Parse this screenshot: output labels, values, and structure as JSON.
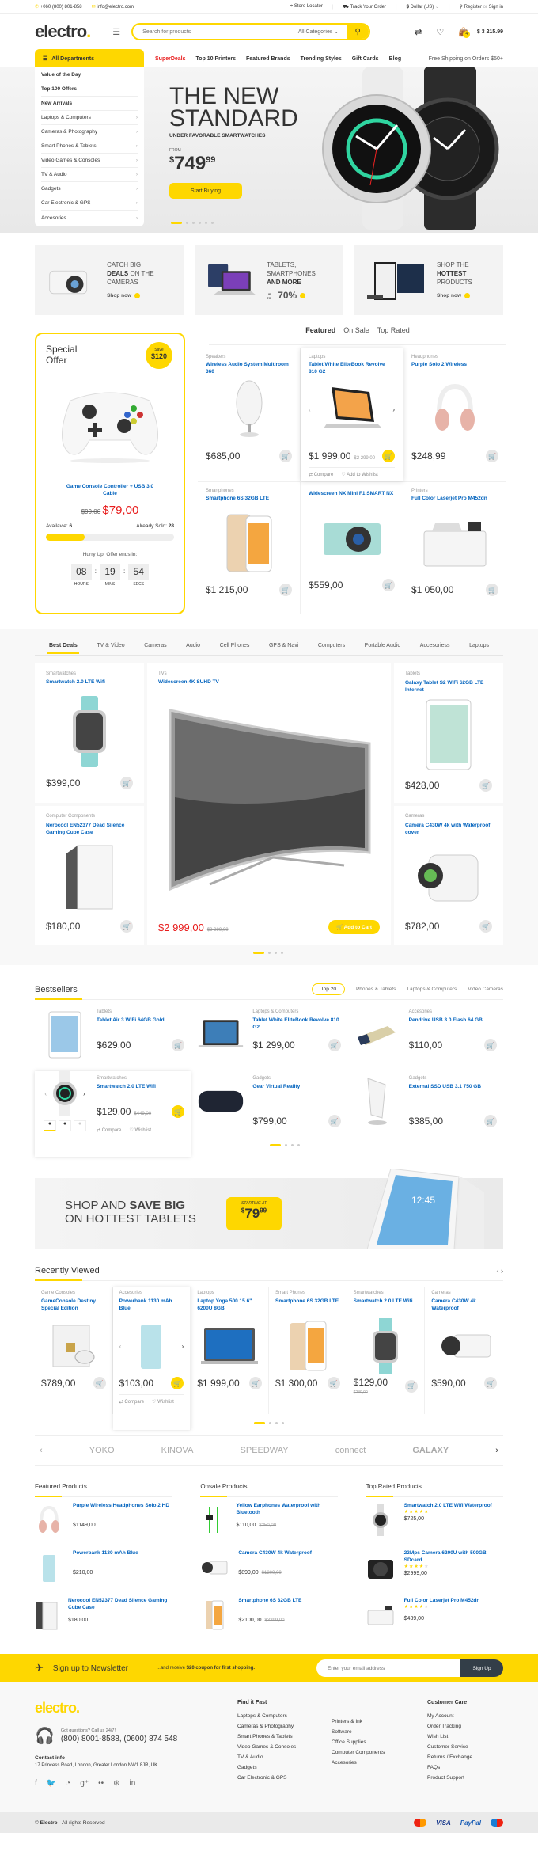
{
  "topbar": {
    "phone": "+060 (800) 801-858",
    "email": "info@electro.com",
    "store_locator": "Store Locator",
    "track_order": "Track Your Order",
    "currency": "Dollar (US)",
    "register": "Register",
    "or": "or",
    "sign_in": "Sign in"
  },
  "header": {
    "logo": "electro",
    "search_placeholder": "Search for products",
    "category_select": "All Categories",
    "cart_count": "4",
    "cart_total": "$ 3 215.99"
  },
  "nav": {
    "all_departments": "All Departments",
    "items": [
      "SuperDeals",
      "Top 10 Printers",
      "Featured Brands",
      "Trending Styles",
      "Gift Cards",
      "Blog"
    ],
    "free_shipping": "Free Shipping on Orders $50+"
  },
  "departments": [
    {
      "label": "Value of the Day",
      "bold": true
    },
    {
      "label": "Top 100 Offers",
      "bold": true
    },
    {
      "label": "New Arrivals",
      "bold": true
    },
    {
      "label": "Laptops & Computers"
    },
    {
      "label": "Cameras & Photography"
    },
    {
      "label": "Smart Phones & Tablets"
    },
    {
      "label": "Video Games & Consoles"
    },
    {
      "label": "TV & Audio"
    },
    {
      "label": "Gadgets"
    },
    {
      "label": "Car Electronic & GPS"
    },
    {
      "label": "Accesories"
    }
  ],
  "hero": {
    "line1": "THE NEW",
    "line2": "STANDARD",
    "subtitle": "UNDER FAVORABLE SMARTWATCHES",
    "from": "FROM",
    "price_main": "749",
    "price_cents": "99",
    "currency": "$",
    "button": "Start Buying",
    "slides": 6,
    "active_slide": 1
  },
  "banners": [
    {
      "pre": "CATCH BIG",
      "bold": "DEALS",
      "post": "ON THE CAMERAS",
      "cta": "Shop now"
    },
    {
      "pre": "TABLETS, SMARTPHONES",
      "bold": "AND MORE",
      "post": "",
      "cta_up": "UP TO",
      "cta": "70%"
    },
    {
      "pre": "SHOP THE",
      "bold": "HOTTEST",
      "post": "PRODUCTS",
      "cta": "Shop now"
    }
  ],
  "special_offer": {
    "title_1": "Special",
    "title_2": "Offer",
    "save_label": "Save",
    "save_amount": "$120",
    "name": "Game Console Controller + USB 3.0 Cable",
    "old_price": "$99,00",
    "price": "$79,00",
    "available_label": "Availavle:",
    "available": "6",
    "sold_label": "Already Sold:",
    "sold": "28",
    "progress_percent": 30,
    "hurry": "Hurry Up! Offer ends in:",
    "hours": "08",
    "mins": "19",
    "secs": "54",
    "hours_label": "HOURS",
    "mins_label": "MINS",
    "secs_label": "SECS"
  },
  "featured_tabs": [
    "Featured",
    "On Sale",
    "Top Rated"
  ],
  "featured_products": [
    {
      "cat": "Speakers",
      "name": "Wireless Audio System Multiroom 360",
      "price": "$685,00"
    },
    {
      "cat": "Laptops",
      "name": "Tablet White EliteBook Revolve 810 G2",
      "price": "$1 999,00",
      "old": "$2 299,00",
      "sale": true,
      "hover": true
    },
    {
      "cat": "Headphones",
      "name": "Purple Solo 2 Wireless",
      "price": "$248,99"
    },
    {
      "cat": "Smartphones",
      "name": "Smartphone 6S 32GB LTE",
      "price": "$1 215,00"
    },
    {
      "cat": "",
      "name": "Widescreen NX Mini F1 SMART NX",
      "price": "$559,00"
    },
    {
      "cat": "Printers",
      "name": "Full Color Laserjet Pro M452dn",
      "price": "$1 050,00"
    }
  ],
  "actions": {
    "compare": "Compare",
    "wishlist": "Add to Wishlist",
    "wishlist_short": "Wishlist",
    "add_to_cart": "Add to Cart"
  },
  "deal_tabs": [
    "Best Deals",
    "TV & Video",
    "Cameras",
    "Audio",
    "Cell Phones",
    "GPS & Navi",
    "Computers",
    "Portable Audio",
    "Accesoriess",
    "Laptops"
  ],
  "deals": {
    "left_top": {
      "cat": "Smartwatches",
      "name": "Smartwatch 2.0 LTE Wifi",
      "price": "$399,00"
    },
    "left_bottom": {
      "cat": "Computer Components",
      "name": "Nerocool EN52377 Dead Silence Gaming Cube Case",
      "price": "$180,00"
    },
    "center": {
      "cat": "TVs",
      "name": "Widescreen 4K SUHD TV",
      "price": "$2 999,00",
      "old": "$3 299,00"
    },
    "right_top": {
      "cat": "Tablets",
      "name": "Galaxy Tablet S2 WiFi 62GB LTE Internet",
      "price": "$428,00"
    },
    "right_bottom": {
      "cat": "Cameras",
      "name": "Camera C430W 4k with Waterproof cover",
      "price": "$782,00"
    }
  },
  "bestsellers": {
    "title": "Bestsellers",
    "tabs": [
      "Top 20",
      "Phones & Tablets",
      "Laptops & Computers",
      "Video Cameras"
    ],
    "items": [
      {
        "cat": "Tablets",
        "name": "Tablet Air 3 WiFi 64GB Gold",
        "price": "$629,00"
      },
      {
        "cat": "Laptops & Computers",
        "name": "Tablet White EliteBook Revolve 810 G2",
        "price": "$1 299,00"
      },
      {
        "cat": "Accesories",
        "name": "Pendrive USB 3.0 Flash 64 GB",
        "price": "$110,00"
      },
      {
        "cat": "Smartwatches",
        "name": "Smartwatch 2.0 LTE Wifi",
        "price": "$129,00",
        "old": "$449,00",
        "sale": true
      },
      {
        "cat": "Gadgets",
        "name": "Gear Virtual Reality",
        "price": "$799,00"
      },
      {
        "cat": "Gadgets",
        "name": "External SSD USB 3.1 750 GB",
        "price": "$385,00"
      }
    ]
  },
  "tablet_banner": {
    "line1_pre": "SHOP AND",
    "line1_bold": "SAVE BIG",
    "line2": "ON HOTTEST TABLETS",
    "starting": "STARTING AT",
    "price_main": "79",
    "price_cents": "99",
    "currency": "$",
    "screen_time": "12:45"
  },
  "recently_viewed": {
    "title": "Recently Viewed",
    "items": [
      {
        "cat": "Game Consoles",
        "name": "GameConsole Destiny Special Edition",
        "price": "$789,00"
      },
      {
        "cat": "Accesories",
        "name": "Powerbank 1130 mAh Blue",
        "price": "$103,00",
        "hover": true
      },
      {
        "cat": "Laptops",
        "name": "Laptop Yoga 500 15.6\" 6200U 8GB",
        "price": "$1 999,00"
      },
      {
        "cat": "Smart Phones",
        "name": "Smartphone 6S 32GB LTE",
        "price": "$1 300,00"
      },
      {
        "cat": "Smartwatches",
        "name": "Smartwatch 2.0 LTE Wifi",
        "price": "$129,00",
        "old": "$249,00",
        "sale": true
      },
      {
        "cat": "Cameras",
        "name": "Camera C430W 4k Waterproof",
        "price": "$590,00"
      }
    ]
  },
  "brands": [
    "YOKO",
    "KINOVA",
    "SPEEDWAY",
    "connect",
    "GALAXY"
  ],
  "lists": [
    {
      "title": "Featured Products",
      "items": [
        {
          "name": "Purple Wireless Headphones Solo 2 HD",
          "price": "$1149,00"
        },
        {
          "name": "Powerbank 1130 mAh Blue",
          "price": "$210,00"
        },
        {
          "name": "Nerocool EN52377 Dead Silence Gaming Cube Case",
          "price": "$180,00"
        }
      ]
    },
    {
      "title": "Onsale Products",
      "items": [
        {
          "name": "Yellow Earphones Waterproof with Bluetooth",
          "price": "$110,00",
          "old": "$250,00"
        },
        {
          "name": "Camera C430W 4k Waterproof",
          "price": "$899,00",
          "old": "$1200,00"
        },
        {
          "name": "Smartphone 6S 32GB LTE",
          "price": "$2100,00",
          "old": "$3299,00"
        }
      ]
    },
    {
      "title": "Top Rated Products",
      "items": [
        {
          "name": "Smartwatch 2.0 LTE Wifi Waterproof",
          "price": "$725,00",
          "rating": 5
        },
        {
          "name": "22Mps Camera 6200U with 500GB SDcard",
          "price": "$2999,00",
          "rating": 4
        },
        {
          "name": "Full Color Laserjet Pro M452dn",
          "price": "$439,00",
          "rating": 4
        }
      ]
    }
  ],
  "newsletter": {
    "title": "Sign up to Newsletter",
    "sub_pre": "...and receive",
    "sub_bold": "$20 coupon for first shopping.",
    "placeholder": "Enter your email address",
    "button": "Sign Up"
  },
  "footer": {
    "logo": "electro",
    "questions": "Got questions? Call us 24/7!",
    "phones": "(800) 8001-8588, (0600) 874 548",
    "contact_title": "Contact info",
    "address": "17 Princess Road, London, Greater London NW1 8JR, UK",
    "find_title": "Find it Fast",
    "find_col1": [
      "Laptops & Computers",
      "Cameras & Photography",
      "Smart Phones & Tablets",
      "Video Games & Consoles",
      "TV & Audio",
      "Gadgets",
      "Car Electronic & GPS"
    ],
    "find_col2": [
      "Printers & Ink",
      "Software",
      "Office Supplies",
      "Computer Components",
      "Accesories"
    ],
    "care_title": "Customer Care",
    "care": [
      "My Account",
      "Order Tracking",
      "Wish List",
      "Customer Service",
      "Returns / Exchange",
      "FAQs",
      "Product Support"
    ],
    "copyright_pre": "©",
    "copyright_brand": "Electro",
    "copyright_post": "- All rights Reserved",
    "payments": [
      "MasterCard",
      "VISA",
      "PayPal",
      "Maestro"
    ]
  },
  "colors": {
    "accent": "#fed700",
    "link": "#0062bd",
    "sale": "#e81c1c",
    "dark": "#333e48"
  }
}
